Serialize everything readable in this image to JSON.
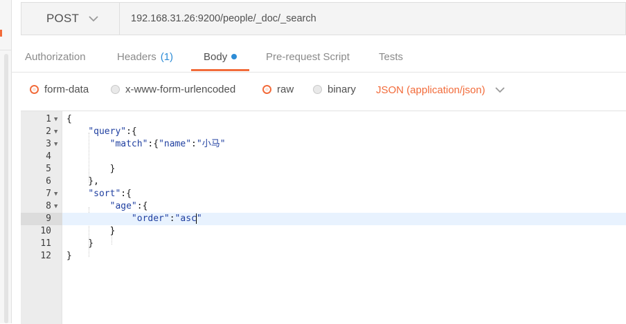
{
  "request": {
    "method": "POST",
    "url": "192.168.31.26:9200/people/_doc/_search"
  },
  "tabs": [
    {
      "label": "Authorization"
    },
    {
      "label": "Headers",
      "count": "(1)"
    },
    {
      "label": "Body",
      "active": true
    },
    {
      "label": "Pre-request Script"
    },
    {
      "label": "Tests"
    }
  ],
  "body_options": {
    "items": [
      {
        "label": "form-data",
        "selected": false
      },
      {
        "label": "x-www-form-urlencoded",
        "selected": false
      },
      {
        "label": "raw",
        "selected": true
      },
      {
        "label": "binary",
        "selected": false
      }
    ],
    "content_type": "JSON (application/json)"
  },
  "editor": {
    "current_line": 9,
    "lines": [
      {
        "n": "1",
        "text": "{"
      },
      {
        "n": "2",
        "text": "    \"query\":{"
      },
      {
        "n": "3",
        "text": "        \"match\":{\"name\":\"小马\""
      },
      {
        "n": "4",
        "text": ""
      },
      {
        "n": "5",
        "text": "        }"
      },
      {
        "n": "6",
        "text": "    },"
      },
      {
        "n": "7",
        "text": "    \"sort\":{"
      },
      {
        "n": "8",
        "text": "        \"age\":{"
      },
      {
        "n": "9",
        "text": "            \"order\":\"asc\""
      },
      {
        "n": "10",
        "text": "        }"
      },
      {
        "n": "11",
        "text": "    }"
      },
      {
        "n": "12",
        "text": "}"
      }
    ]
  },
  "colors": {
    "accent": "#f26b3a",
    "active_blue": "#2d8cd6",
    "string": "#1f3fa0",
    "current_line": "#e8f2fe"
  },
  "icons": {
    "method_dropdown": "chevron-down-icon",
    "content_type_dropdown": "chevron-down-icon",
    "fold_marker": "fold-arrow-icon"
  }
}
